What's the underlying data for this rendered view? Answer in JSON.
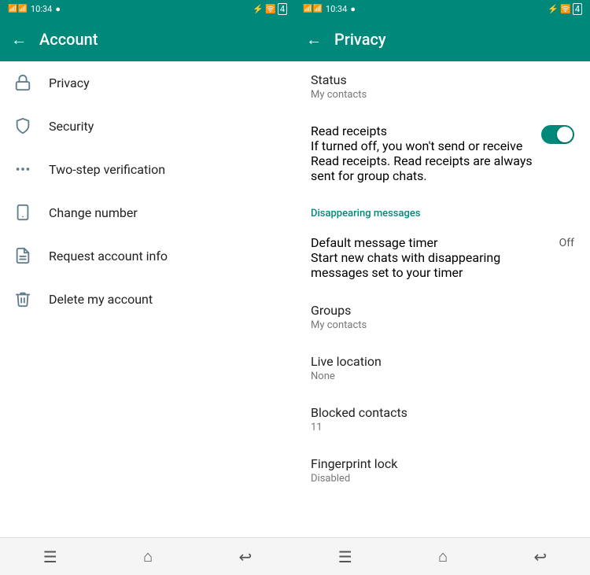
{
  "account_screen": {
    "status_bar": {
      "time": "10:34",
      "signal": "●"
    },
    "header": {
      "title": "Account",
      "back_label": "←"
    },
    "menu_items": [
      {
        "id": "privacy",
        "label": "Privacy",
        "icon": "lock"
      },
      {
        "id": "security",
        "label": "Security",
        "icon": "shield"
      },
      {
        "id": "two_step",
        "label": "Two-step verification",
        "icon": "dots"
      },
      {
        "id": "change_number",
        "label": "Change number",
        "icon": "phone"
      },
      {
        "id": "request_info",
        "label": "Request account info",
        "icon": "file"
      },
      {
        "id": "delete_account",
        "label": "Delete my account",
        "icon": "trash"
      }
    ],
    "bottom_nav": {
      "menu_icon": "☰",
      "home_icon": "⌂",
      "back_icon": "↩"
    }
  },
  "privacy_screen": {
    "status_bar": {
      "time": "10:34",
      "signal": "●"
    },
    "header": {
      "title": "Privacy",
      "back_label": "←"
    },
    "items": [
      {
        "id": "status",
        "title": "Status",
        "value": "My contacts"
      },
      {
        "id": "read_receipts",
        "title": "Read receipts",
        "description": "If turned off, you won't send or receive Read receipts. Read receipts are always sent for group chats.",
        "toggle": true
      },
      {
        "id": "disappearing_section",
        "section_label": "Disappearing messages"
      },
      {
        "id": "default_timer",
        "title": "Default message timer",
        "description": "Start new chats with disappearing messages set to your timer",
        "value": "Off"
      },
      {
        "id": "groups",
        "title": "Groups",
        "value": "My contacts"
      },
      {
        "id": "live_location",
        "title": "Live location",
        "value": "None"
      },
      {
        "id": "blocked_contacts",
        "title": "Blocked contacts",
        "value": "11"
      },
      {
        "id": "fingerprint",
        "title": "Fingerprint lock",
        "value": "Disabled"
      }
    ],
    "bottom_nav": {
      "menu_icon": "☰",
      "home_icon": "⌂",
      "back_icon": "↩"
    }
  }
}
